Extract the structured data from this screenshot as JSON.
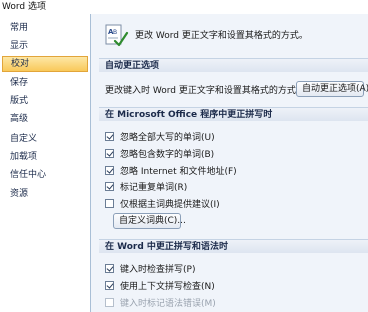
{
  "window": {
    "title": "Word 选项"
  },
  "sidebar": {
    "items": [
      {
        "label": "常用",
        "active": false
      },
      {
        "label": "显示",
        "active": false
      },
      {
        "label": "校对",
        "active": true
      },
      {
        "label": "保存",
        "active": false
      },
      {
        "label": "版式",
        "active": false
      },
      {
        "label": "高级",
        "active": false
      },
      {
        "label": "自定义",
        "active": false
      },
      {
        "label": "加载项",
        "active": false
      },
      {
        "label": "信任中心",
        "active": false
      },
      {
        "label": "资源",
        "active": false
      }
    ]
  },
  "main": {
    "header": {
      "icon": "abc-spellcheck-icon",
      "text": "更改 Word 更正文字和设置其格式的方式。"
    },
    "autocorrect": {
      "title": "自动更正选项",
      "description": "更改键入时 Word 更正文字和设置其格式的方式:",
      "button_label": "自动更正选项(A)..."
    },
    "office_spelling": {
      "title": "在 Microsoft Office 程序中更正拼写时",
      "options": [
        {
          "label": "忽略全部大写的单词(U)",
          "checked": true
        },
        {
          "label": "忽略包含数字的单词(B)",
          "checked": true
        },
        {
          "label": "忽略 Internet 和文件地址(F)",
          "checked": true
        },
        {
          "label": "标记重复单词(R)",
          "checked": true
        },
        {
          "label": "仅根据主词典提供建议(I)",
          "checked": false
        }
      ],
      "custom_dict_button": "自定义词典(C)..."
    },
    "word_spelling": {
      "title": "在 Word 中更正拼写和语法时",
      "options": [
        {
          "label": "键入时检查拼写(P)",
          "checked": true,
          "disabled": false
        },
        {
          "label": "使用上下文拼写检查(N)",
          "checked": true,
          "disabled": false
        },
        {
          "label": "键入时标记语法错误(M)",
          "checked": false,
          "disabled": true
        }
      ]
    }
  }
}
